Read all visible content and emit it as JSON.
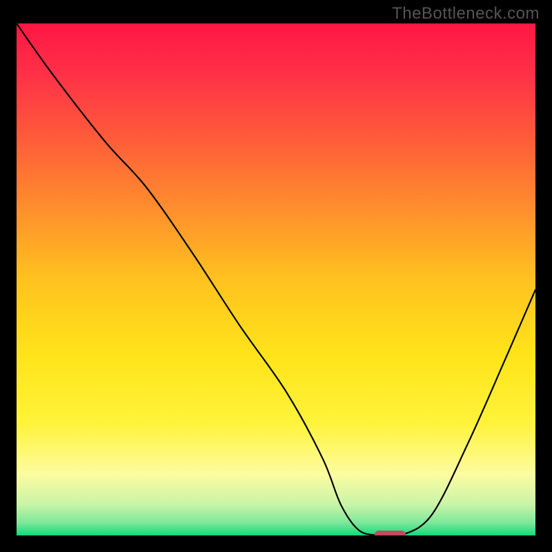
{
  "watermark": "TheBottleneck.com",
  "chart_data": {
    "type": "line",
    "title": "",
    "xlabel": "",
    "ylabel": "",
    "xlim": [
      0,
      100
    ],
    "ylim": [
      0,
      100
    ],
    "grid": false,
    "legend": false,
    "gradient_stops": [
      {
        "offset": 0,
        "color": "#ff1744"
      },
      {
        "offset": 0.1,
        "color": "#ff3147"
      },
      {
        "offset": 0.22,
        "color": "#ff5a3a"
      },
      {
        "offset": 0.35,
        "color": "#ff8a2e"
      },
      {
        "offset": 0.5,
        "color": "#ffc21f"
      },
      {
        "offset": 0.65,
        "color": "#ffe41a"
      },
      {
        "offset": 0.78,
        "color": "#fff33a"
      },
      {
        "offset": 0.88,
        "color": "#fdfca0"
      },
      {
        "offset": 0.94,
        "color": "#c8f4a8"
      },
      {
        "offset": 0.975,
        "color": "#7de89a"
      },
      {
        "offset": 1.0,
        "color": "#17d87a"
      }
    ],
    "curve": {
      "x": [
        0,
        7,
        17,
        25,
        34,
        43,
        52,
        59,
        62.5,
        66,
        70,
        74,
        80,
        87,
        94,
        100
      ],
      "y": [
        100,
        90,
        77,
        68,
        55,
        41,
        28,
        15,
        6,
        1,
        0,
        0,
        4,
        18,
        34,
        48
      ]
    },
    "marker": {
      "x_center": 72,
      "y": 0,
      "width": 6,
      "color": "#c44a5b"
    }
  }
}
